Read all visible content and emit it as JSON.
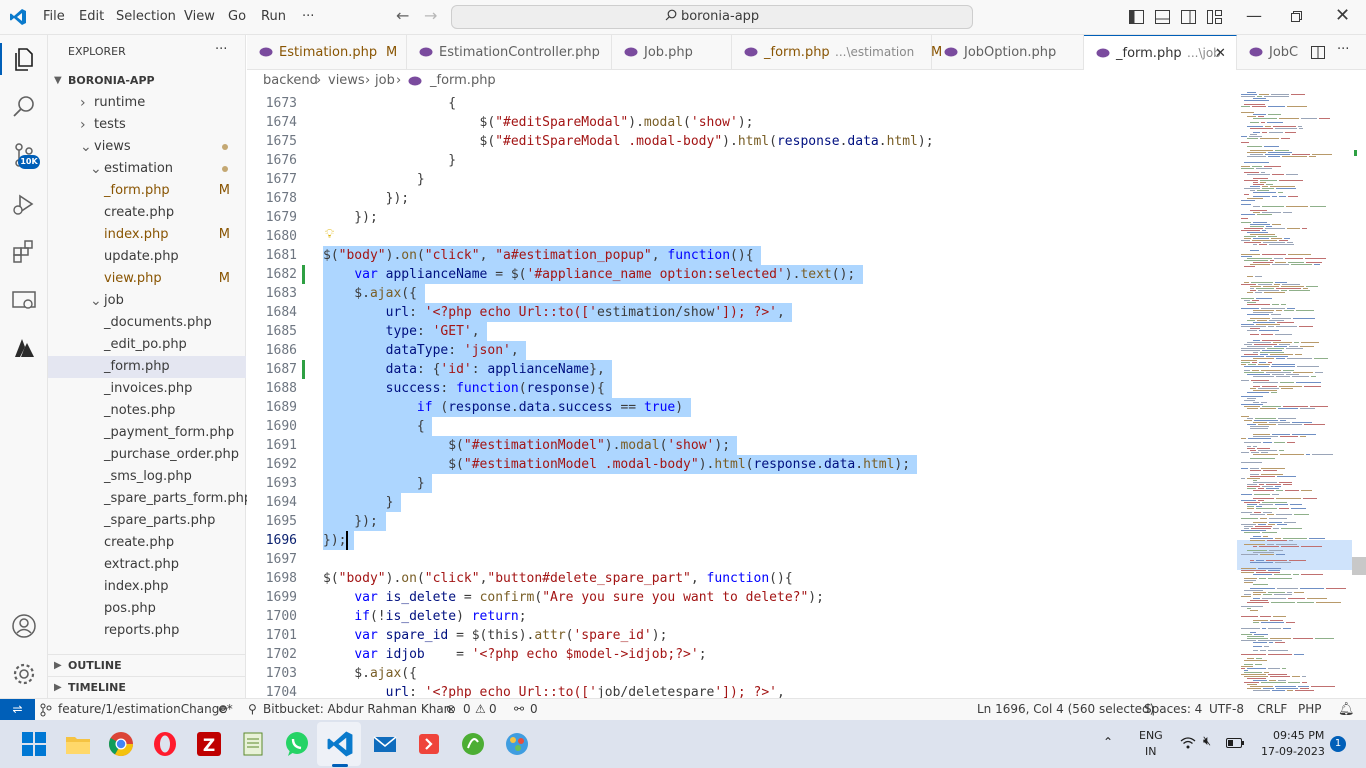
{
  "titlebar": {
    "menus": [
      "File",
      "Edit",
      "Selection",
      "View",
      "Go",
      "Run"
    ],
    "more": "···",
    "search_text": "boronia-app"
  },
  "sidebar": {
    "title": "EXPLORER",
    "more": "···",
    "project": "BORONIA-APP",
    "rows": [
      {
        "label": "runtime",
        "type": "folder",
        "state": "collapsed",
        "mark": ""
      },
      {
        "label": "tests",
        "type": "folder",
        "state": "collapsed",
        "mark": ""
      },
      {
        "label": "views",
        "type": "folder",
        "state": "expanded",
        "mark": "dot"
      },
      {
        "label": "estimation",
        "type": "folder",
        "state": "expanded",
        "mark": "dot"
      },
      {
        "label": "_form.php",
        "type": "file",
        "mark": "M"
      },
      {
        "label": "create.php",
        "type": "file",
        "mark": ""
      },
      {
        "label": "index.php",
        "type": "file",
        "mark": "M"
      },
      {
        "label": "update.php",
        "type": "file",
        "mark": ""
      },
      {
        "label": "view.php",
        "type": "file",
        "mark": "M"
      },
      {
        "label": "job",
        "type": "folder",
        "state": "expanded",
        "mark": ""
      },
      {
        "label": "_documents.php",
        "type": "file",
        "mark": ""
      },
      {
        "label": "_edit_po.php",
        "type": "file",
        "mark": ""
      },
      {
        "label": "_form.php",
        "type": "file",
        "mark": "",
        "selected": true
      },
      {
        "label": "_invoices.php",
        "type": "file",
        "mark": ""
      },
      {
        "label": "_notes.php",
        "type": "file",
        "mark": ""
      },
      {
        "label": "_payment_form.php",
        "type": "file",
        "mark": ""
      },
      {
        "label": "_purchase_order.php",
        "type": "file",
        "mark": ""
      },
      {
        "label": "_sms_log.php",
        "type": "file",
        "mark": ""
      },
      {
        "label": "_spare_parts_form.php",
        "type": "file",
        "mark": ""
      },
      {
        "label": "_spare_parts.php",
        "type": "file",
        "mark": ""
      },
      {
        "label": "create.php",
        "type": "file",
        "mark": ""
      },
      {
        "label": "extract.php",
        "type": "file",
        "mark": ""
      },
      {
        "label": "index.php",
        "type": "file",
        "mark": ""
      },
      {
        "label": "pos.php",
        "type": "file",
        "mark": ""
      },
      {
        "label": "reports.php",
        "type": "file",
        "mark": ""
      }
    ],
    "outline": "OUTLINE",
    "timeline": "TIMELINE"
  },
  "tabs": [
    {
      "label": "Estimation.php",
      "mark": "M",
      "desc": ""
    },
    {
      "label": "EstimationController.php",
      "mark": "",
      "desc": ""
    },
    {
      "label": "Job.php",
      "mark": "",
      "desc": ""
    },
    {
      "label": "_form.php",
      "mark": "M",
      "desc": "...\\estimation"
    },
    {
      "label": "JobOption.php",
      "mark": "",
      "desc": ""
    },
    {
      "label": "_form.php",
      "mark": "",
      "desc": "...\\job",
      "active": true
    },
    {
      "label": "JobC",
      "mark": "",
      "desc": ""
    }
  ],
  "breadcrumb": [
    "backend",
    "views",
    "job",
    "_form.php"
  ],
  "editor": {
    "lines": [
      {
        "n": "1673",
        "text": "                {"
      },
      {
        "n": "1674",
        "text": "                    $(\"#editSpareModal\").modal('show');"
      },
      {
        "n": "1675",
        "text": "                    $(\"#editSpareModal .modal-body\").html(response.data.html);"
      },
      {
        "n": "1676",
        "text": "                }"
      },
      {
        "n": "1677",
        "text": "            }"
      },
      {
        "n": "1678",
        "text": "        });"
      },
      {
        "n": "1679",
        "text": "    });"
      },
      {
        "n": "1680",
        "text": ""
      },
      {
        "n": "1681",
        "text": "$(\"body\").on(\"click\", \"a#estimation_popup\", function(){"
      },
      {
        "n": "1682",
        "text": "    var applianceName = $('#appliance_name option:selected').text();"
      },
      {
        "n": "1683",
        "text": "    $.ajax({"
      },
      {
        "n": "1684",
        "text": "        url: '<?php echo Url::to(['estimation/show']); ?>',"
      },
      {
        "n": "1685",
        "text": "        type: 'GET',"
      },
      {
        "n": "1686",
        "text": "        dataType: 'json',"
      },
      {
        "n": "1687",
        "text": "        data: {'id': applianceName},"
      },
      {
        "n": "1688",
        "text": "        success: function(response){"
      },
      {
        "n": "1689",
        "text": "            if (response.data.success == true)"
      },
      {
        "n": "1690",
        "text": "            {"
      },
      {
        "n": "1691",
        "text": "                $(\"#estimationModel\").modal('show');"
      },
      {
        "n": "1692",
        "text": "                $(\"#estimationModel .modal-body\").html(response.data.html);"
      },
      {
        "n": "1693",
        "text": "            }"
      },
      {
        "n": "1694",
        "text": "        }"
      },
      {
        "n": "1695",
        "text": "    });"
      },
      {
        "n": "1696",
        "text": "});"
      },
      {
        "n": "1697",
        "text": ""
      },
      {
        "n": "1698",
        "text": "$(\"body\").on(\"click\",\"button#delete_spare_part\", function(){"
      },
      {
        "n": "1699",
        "text": "    var is_delete = confirm(\"Are you sure you want to delete?\");"
      },
      {
        "n": "1700",
        "text": "    if(!is_delete) return;"
      },
      {
        "n": "1701",
        "text": "    var spare_id = $(this).attr('spare_id');"
      },
      {
        "n": "1702",
        "text": "    var idjob    = '<?php echo $model->idjob;?>';"
      },
      {
        "n": "1703",
        "text": "    $.ajax({"
      },
      {
        "n": "1704",
        "text": "        url: '<?php echo Url::to(['job/deletespare']); ?>',"
      }
    ]
  },
  "statusbar": {
    "branch": "feature/1/estimationChange*",
    "bitbucket": "Bitbucket: Abdur Rahman Khan:",
    "errors": "0",
    "warnings": "0",
    "ports": "0",
    "position": "Ln 1696, Col 4 (560 selected)",
    "spaces": "Spaces: 4",
    "encoding": "UTF-8",
    "eol": "CRLF",
    "language": "PHP"
  },
  "taskbar": {
    "lang1": "ENG",
    "lang2": "IN",
    "time": "09:45 PM",
    "date": "17-09-2023",
    "notif_count": "1"
  }
}
